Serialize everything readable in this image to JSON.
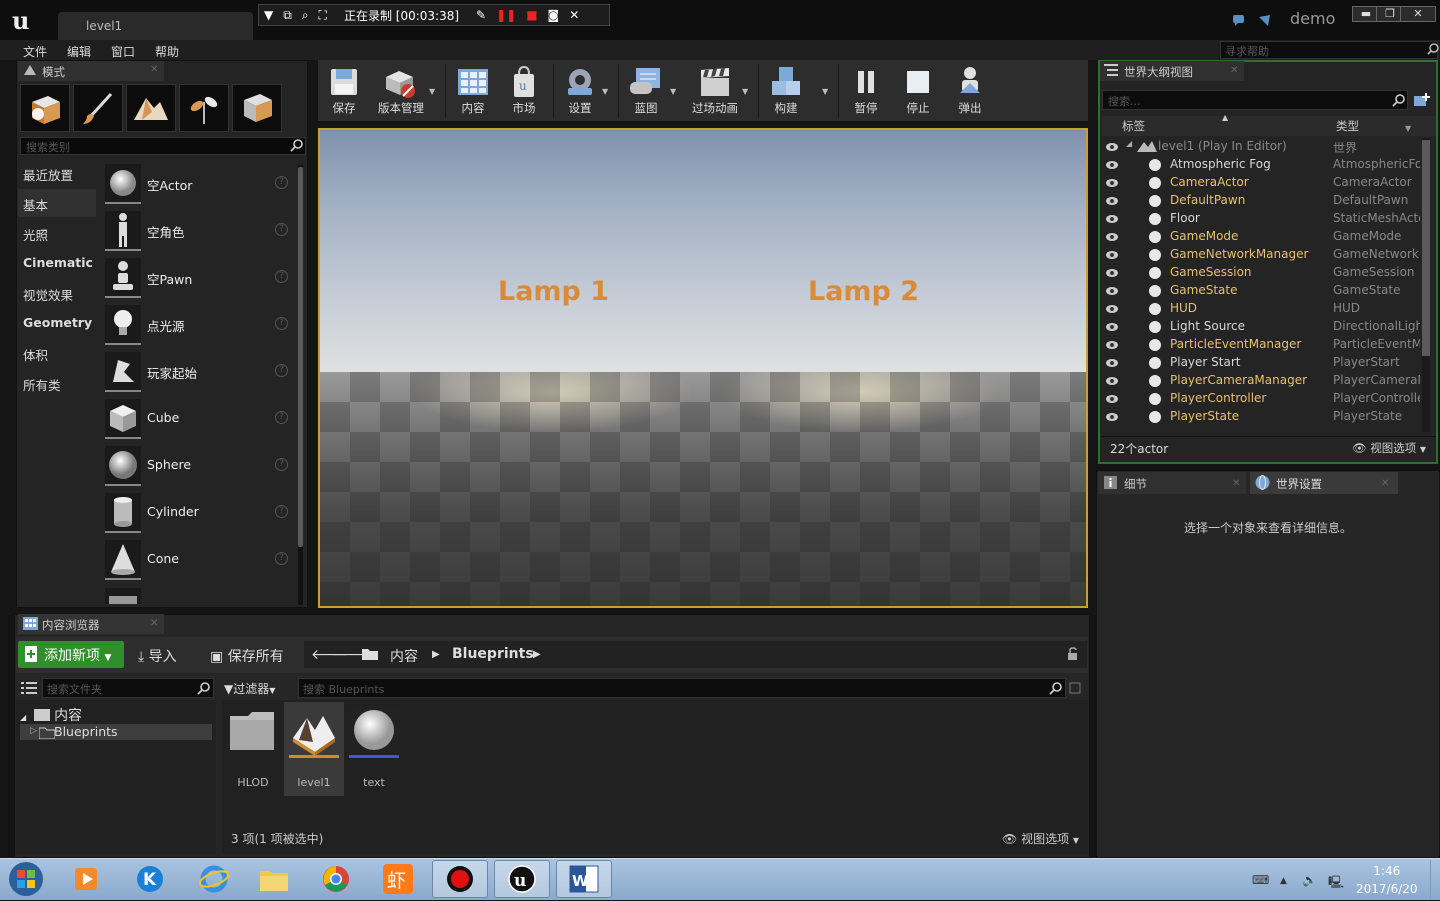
{
  "window": {
    "tab_title": "level1",
    "user_label": "demo",
    "recording_status": "正在录制 [00:03:38]",
    "controls": {
      "minimize": "▬",
      "maximize": "❐",
      "close": "✕"
    }
  },
  "menu": {
    "items": [
      "文件",
      "编辑",
      "窗口",
      "帮助"
    ],
    "help_search_placeholder": "寻求帮助"
  },
  "modes": {
    "tab_label": "模式",
    "search_placeholder": "搜索类别",
    "categories": [
      "最近放置",
      "基本",
      "光照",
      "Cinematic",
      "视觉效果",
      "Geometry",
      "体积",
      "所有类"
    ],
    "active_category": "基本",
    "place_items": [
      "空Actor",
      "空角色",
      "空Pawn",
      "点光源",
      "玩家起始",
      "Cube",
      "Sphere",
      "Cylinder",
      "Cone"
    ],
    "help_glyph": "?"
  },
  "toolbar": {
    "buttons": [
      "保存",
      "版本管理",
      "内容",
      "市场",
      "设置",
      "蓝图",
      "过场动画",
      "构建",
      "暂停",
      "停止",
      "弹出"
    ]
  },
  "viewport": {
    "lamp1_label": "Lamp 1",
    "lamp2_label": "Lamp 2"
  },
  "content_browser": {
    "tab_label": "内容浏览器",
    "add_new": "添加新项",
    "import": "导入",
    "save_all": "保存所有",
    "crumb_root": "内容",
    "crumb_current": "Blueprints",
    "folder_search_placeholder": "搜索文件夹",
    "filter_label": "过滤器",
    "asset_search_placeholder": "搜索 Blueprints",
    "tree_root": "内容",
    "tree_child": "Blueprints",
    "assets": [
      "HLOD",
      "level1",
      "text"
    ],
    "item_count": "3 项(1 项被选中)",
    "view_options": "视图选项"
  },
  "outliner": {
    "tab_label": "世界大纲视图",
    "search_placeholder": "搜索...",
    "col_label": "标签",
    "col_type": "类型",
    "root": {
      "name": "level1 (Play In Editor)",
      "type": "世界"
    },
    "rows": [
      {
        "name": "Atmospheric Fog",
        "type": "AtmosphericFog",
        "color": "#d8d8d8"
      },
      {
        "name": "CameraActor",
        "type": "CameraActor",
        "color": "#e8c070"
      },
      {
        "name": "DefaultPawn",
        "type": "DefaultPawn",
        "color": "#e8c070"
      },
      {
        "name": "Floor",
        "type": "StaticMeshActor",
        "color": "#d8d8d8"
      },
      {
        "name": "GameMode",
        "type": "GameMode",
        "color": "#e8c070"
      },
      {
        "name": "GameNetworkManager",
        "type": "GameNetworkManager",
        "color": "#e8c070"
      },
      {
        "name": "GameSession",
        "type": "GameSession",
        "color": "#e8c070"
      },
      {
        "name": "GameState",
        "type": "GameState",
        "color": "#e8c070"
      },
      {
        "name": "HUD",
        "type": "HUD",
        "color": "#e8c070"
      },
      {
        "name": "Light Source",
        "type": "DirectionalLight",
        "color": "#d8d8d8"
      },
      {
        "name": "ParticleEventManager",
        "type": "ParticleEventManager",
        "color": "#e8c070"
      },
      {
        "name": "Player Start",
        "type": "PlayerStart",
        "color": "#d8d8d8"
      },
      {
        "name": "PlayerCameraManager",
        "type": "PlayerCameraManager",
        "color": "#e8c070"
      },
      {
        "name": "PlayerController",
        "type": "PlayerController",
        "color": "#e8c070"
      },
      {
        "name": "PlayerState",
        "type": "PlayerState",
        "color": "#e8c070"
      }
    ],
    "actor_count": "22个actor",
    "view_options": "视图选项"
  },
  "details": {
    "tab_label": "细节",
    "world_settings_tab": "世界设置",
    "empty_message": "选择一个对象来查看详细信息。"
  },
  "taskbar": {
    "time": "1:46",
    "date": "2017/6/20"
  },
  "colors": {
    "accent_green": "#2f8f2a",
    "viewport_border": "#c8a032",
    "lamp_text": "#d98b3a"
  }
}
